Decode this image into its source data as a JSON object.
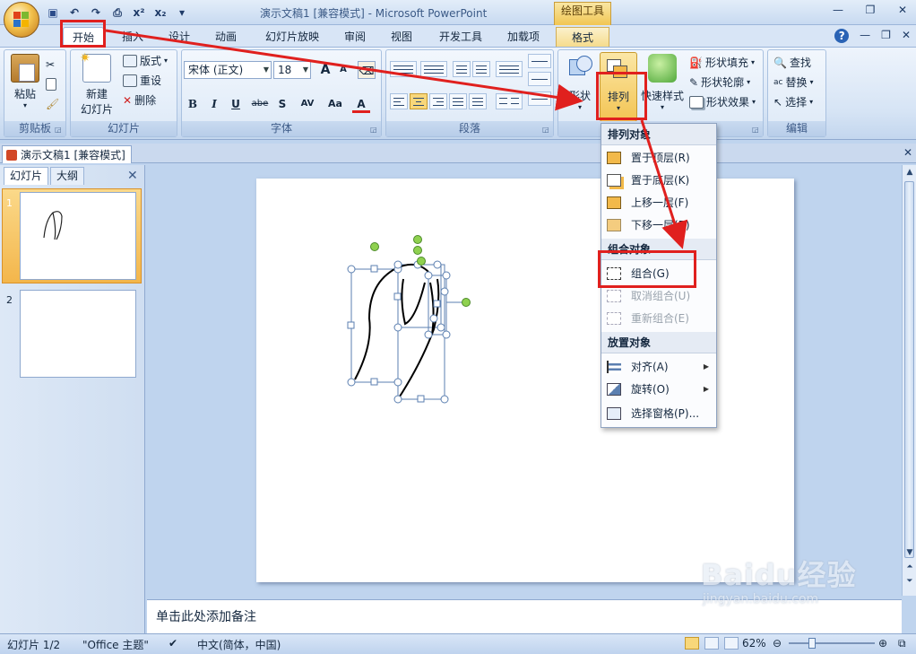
{
  "window": {
    "title": "演示文稿1 [兼容模式] - Microsoft PowerPoint",
    "context_tools_label": "绘图工具",
    "minimize": "—",
    "restore": "❐",
    "close": "✕"
  },
  "qat": {
    "undo": "↶",
    "redo": "↷",
    "superscript": "x²",
    "subscript": "x₂",
    "customize": "▾"
  },
  "tabs": [
    "开始",
    "插入",
    "设计",
    "动画",
    "幻灯片放映",
    "审阅",
    "视图",
    "开发工具",
    "加载项",
    "格式"
  ],
  "ribbon_right": {
    "help": "?",
    "min": "—",
    "restore": "❐",
    "close": "✕"
  },
  "clipboard": {
    "label": "剪贴板",
    "paste": "粘贴"
  },
  "slides_group": {
    "label": "幻灯片",
    "new_slide": "新建",
    "new_slide2": "幻灯片",
    "layout": "版式",
    "reset": "重设",
    "delete": "删除"
  },
  "font_group": {
    "label": "字体",
    "font_name": "宋体 (正文)",
    "font_size": "18",
    "grow": "A",
    "shrink": "A",
    "bold": "B",
    "italic": "I",
    "underline": "U",
    "strike": "abe",
    "shadow": "S",
    "spacing": "AV",
    "case": "Aa",
    "color": "A"
  },
  "paragraph_group": {
    "label": "段落"
  },
  "drawing_group": {
    "shape": "形状",
    "arrange": "排列",
    "quick_styles": "快速样式",
    "fill": "形状填充",
    "outline": "形状轮廓",
    "effects": "形状效果"
  },
  "editing_group": {
    "label": "编辑",
    "find": "查找",
    "replace": "替换",
    "select": "选择"
  },
  "doc_tab": "演示文稿1 [兼容模式]",
  "left_pane": {
    "tab_slides": "幻灯片",
    "tab_outline": "大纲",
    "close": "✕",
    "slide1_num": "1",
    "slide2_num": "2"
  },
  "menu": {
    "head_arrange": "排列对象",
    "bring_front": "置于顶层(R)",
    "send_back": "置于底层(K)",
    "bring_forward": "上移一层(F)",
    "send_backward": "下移一层(B)",
    "head_group": "组合对象",
    "group": "组合(G)",
    "ungroup": "取消组合(U)",
    "regroup": "重新组合(E)",
    "head_place": "放置对象",
    "align": "对齐(A)",
    "rotate": "旋转(O)",
    "selection_pane": "选择窗格(P)..."
  },
  "notes_placeholder": "单击此处添加备注",
  "status": {
    "slide_index": "幻灯片 1/2",
    "theme": "\"Office 主题\"",
    "language": "中文(简体，中国)",
    "zoom": "62%"
  },
  "watermark": {
    "main": "Baidu经验",
    "sub": "jingyan.baidu.com"
  },
  "colors": {
    "accent_red": "#e0201e",
    "ribbon": "#d6e4f5",
    "context_gold": "#f1c653"
  }
}
